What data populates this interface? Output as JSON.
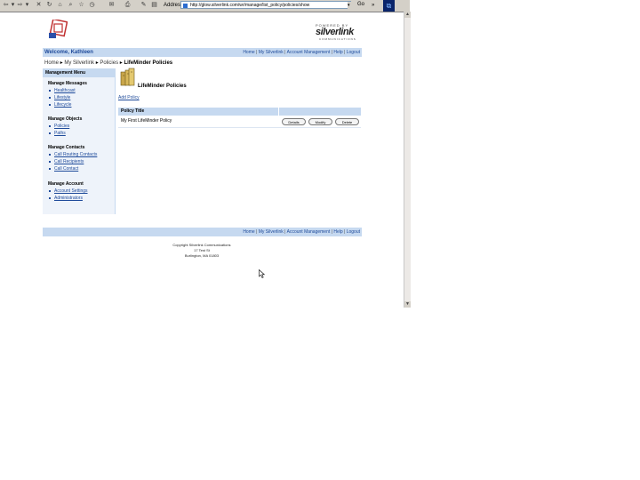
{
  "browser": {
    "nav_buttons": [
      "⇦",
      "▾",
      "⇨",
      "▾",
      "✕",
      "↻",
      "⌂",
      "⌕",
      "☆",
      "◷",
      "✉",
      "⎙",
      "✎",
      "▤"
    ],
    "address_label": "Address",
    "address_value": "http://glow.silverlink.com/wr/manage/list_policy/policies/show",
    "go_label": "Go",
    "links_label": "»"
  },
  "brand": {
    "powered_by": "POWERED BY",
    "name": "silverlink",
    "tagline": "COMMUNICATIONS"
  },
  "header": {
    "welcome": "Welcome, Kathleen",
    "links": [
      "Home",
      "My Silverlink",
      "Account Management",
      "Help",
      "Logout"
    ]
  },
  "breadcrumb": {
    "items": [
      "Home",
      "My Silverlink",
      "Policies"
    ],
    "current": "LifeMinder Policies"
  },
  "sidebar": {
    "title": "Management Menu",
    "groups": [
      {
        "title": "Manage Messages",
        "items": [
          "Healthcast",
          "Lifestyle",
          "Lifecycle"
        ]
      },
      {
        "title": "Manage Objects",
        "items": [
          "Policies",
          "Paths"
        ]
      },
      {
        "title": "Manage Contacts",
        "items": [
          "Call Routing Contacts",
          "Call Recipients",
          "Call Contact"
        ]
      },
      {
        "title": "Manage Account",
        "items": [
          "Account Settings",
          "Administrators"
        ]
      }
    ]
  },
  "main": {
    "title": "LifeMinder Policies",
    "add_link": "Add Policy",
    "table": {
      "header": "Policy Title",
      "rows": [
        {
          "title": "My First LifeMinder Policy",
          "actions": [
            "Details",
            "Modify",
            "Delete"
          ]
        }
      ]
    }
  },
  "footer": {
    "links": [
      "Home",
      "My Silverlink",
      "Account Management",
      "Help",
      "Logout"
    ],
    "copyright": [
      "Copyright Silverlink Communications",
      "17 Test St",
      "Burlington, MA 01803"
    ]
  },
  "colors": {
    "bar": "#c6d9f0",
    "link": "#1e4a9a",
    "sidebar_bg": "#eef3fa"
  }
}
